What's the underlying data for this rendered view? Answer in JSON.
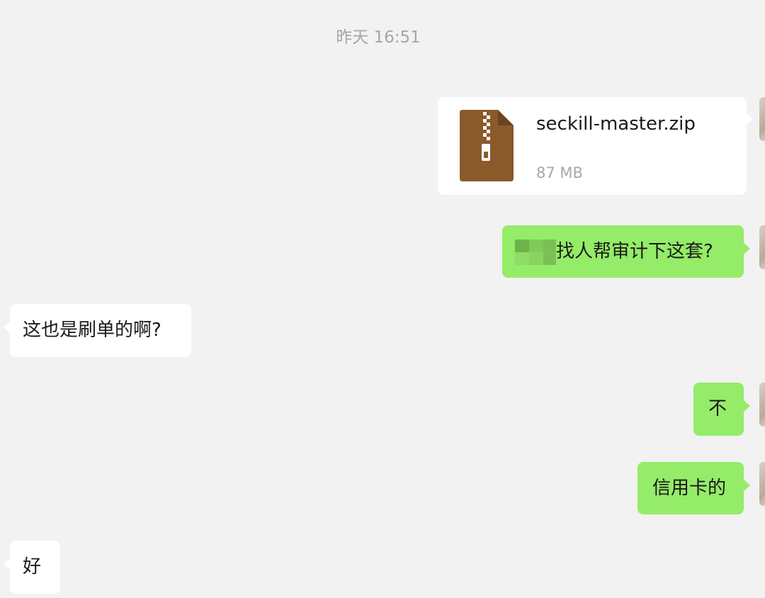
{
  "timestamp": "昨天 16:51",
  "file_message": {
    "file_name": "seckill-master.zip",
    "file_size": "87 MB",
    "icon": "zip-archive-icon",
    "icon_color": "#8a5a2b"
  },
  "messages": [
    {
      "side": "out",
      "text": "找人帮审计下这套?",
      "redacted_prefix": true
    },
    {
      "side": "in",
      "text": "这也是刷单的啊?"
    },
    {
      "side": "out",
      "text": "不"
    },
    {
      "side": "out",
      "text": "信用卡的"
    },
    {
      "side": "in",
      "text": "好"
    }
  ],
  "colors": {
    "background": "#f2f2f2",
    "outgoing_bubble": "#95ec69",
    "incoming_bubble": "#ffffff",
    "timestamp": "#a6a6a6"
  }
}
